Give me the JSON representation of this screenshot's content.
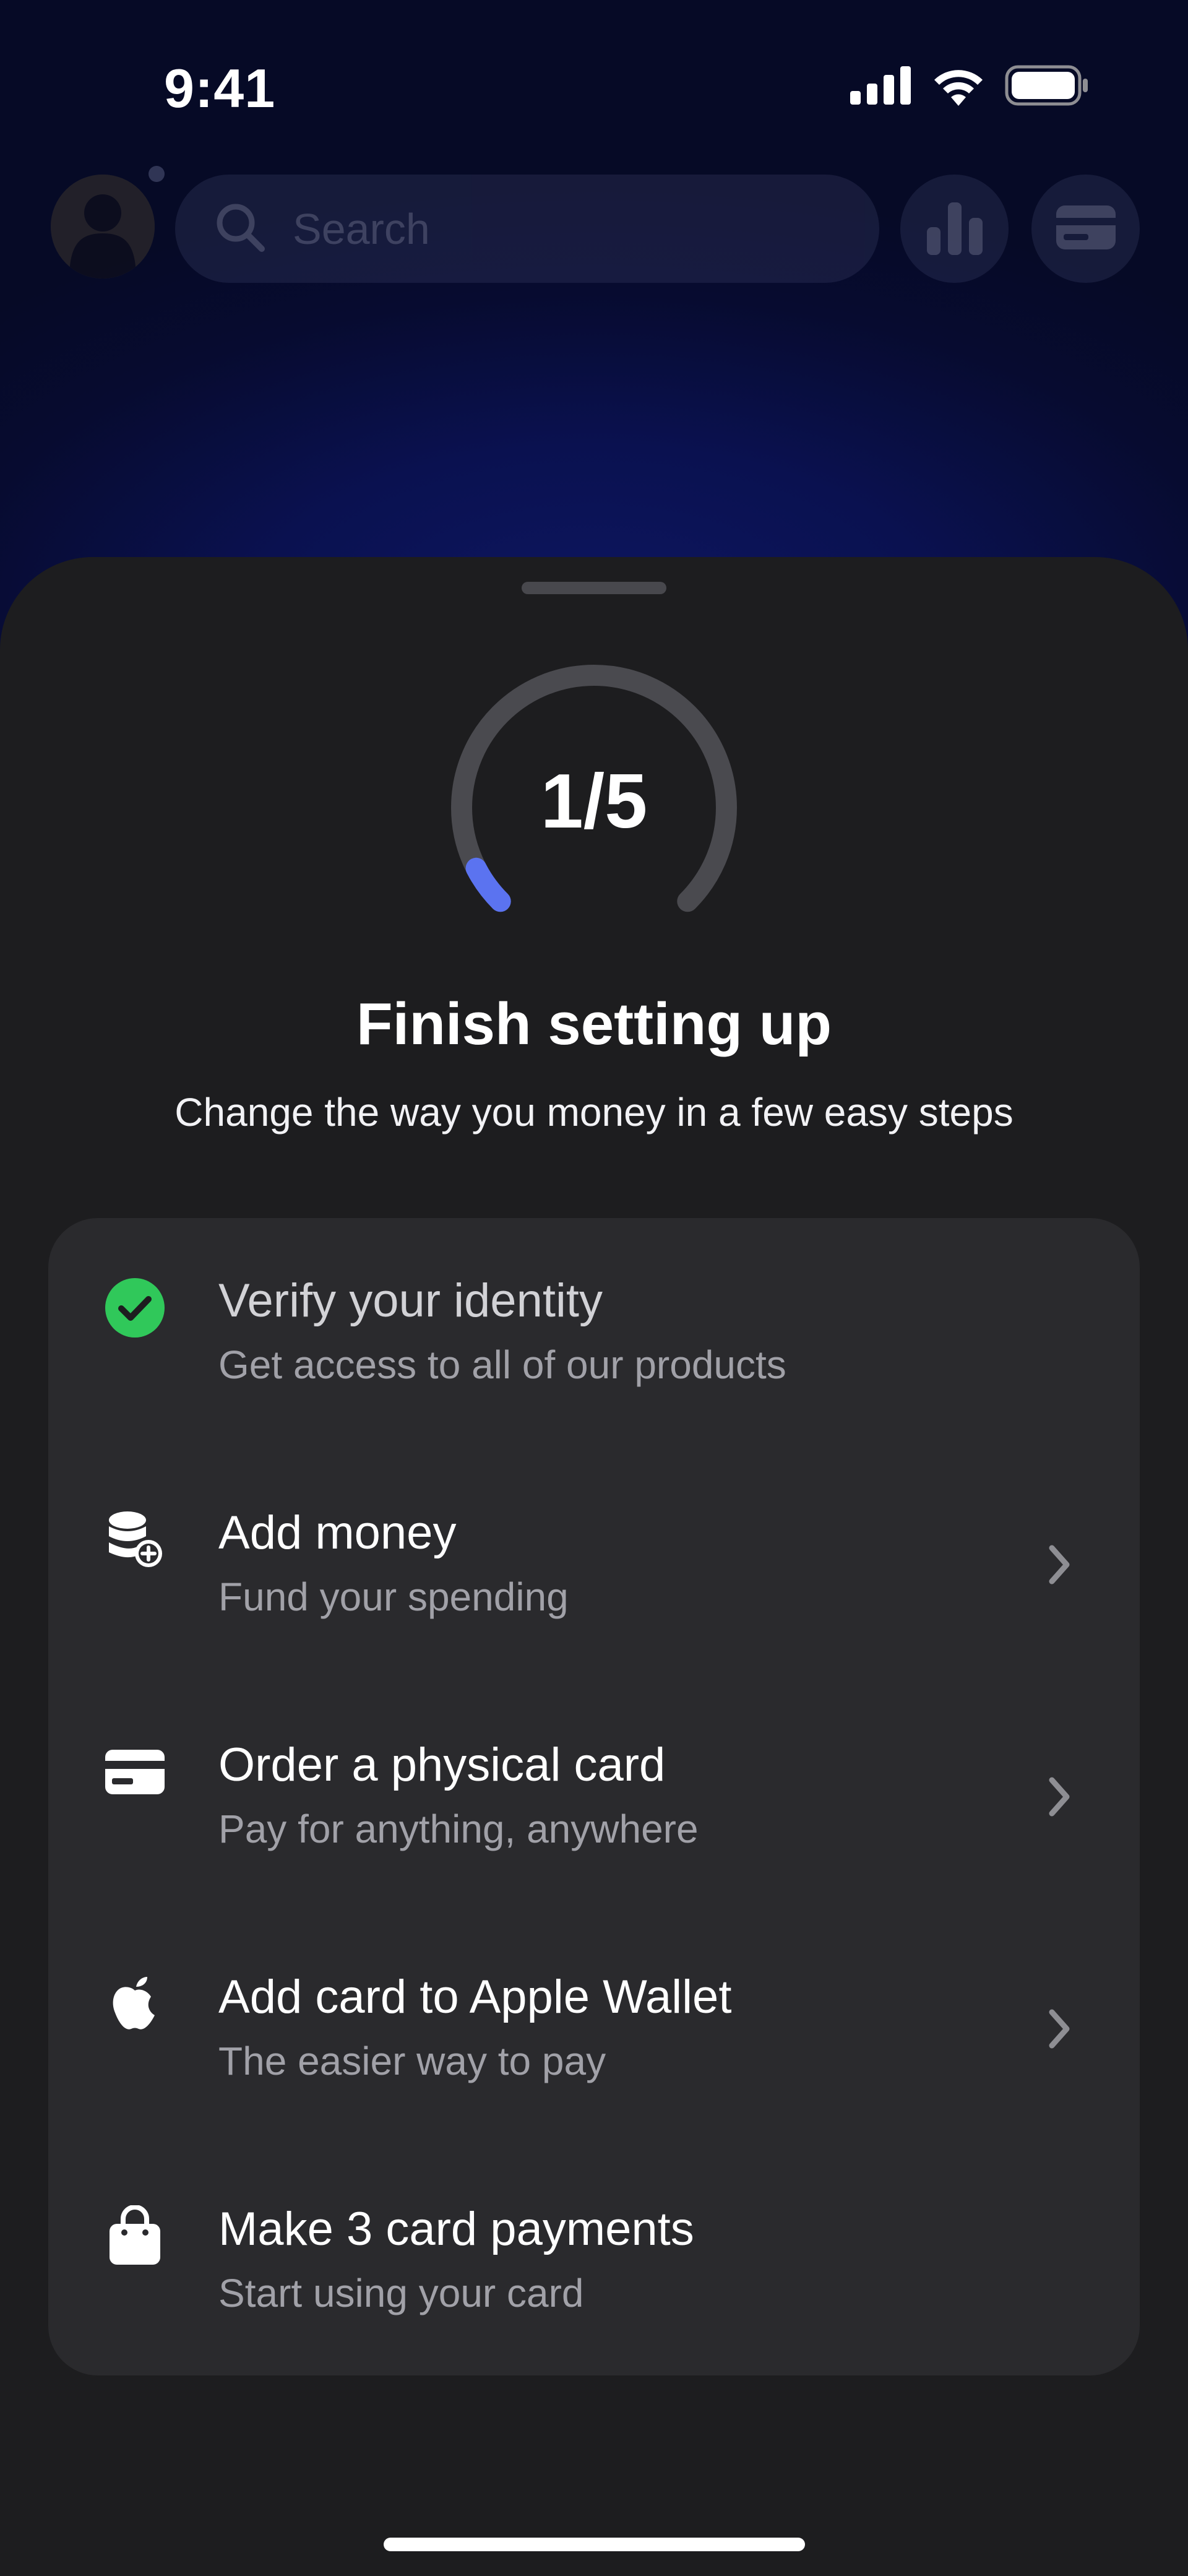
{
  "status_bar": {
    "time": "9:41",
    "icons": [
      "cellular-signal-icon",
      "wifi-icon",
      "battery-icon"
    ]
  },
  "background_app": {
    "search_placeholder": "Search",
    "buttons": [
      "analytics-icon",
      "cards-icon"
    ]
  },
  "sheet": {
    "progress": {
      "label": "1/5",
      "completed": 1,
      "total": 5
    },
    "title": "Finish setting up",
    "subtitle": "Change the way you money in a few easy steps",
    "steps": [
      {
        "title": "Verify your identity",
        "description": "Get access to all of our products",
        "icon": "checkmark-circle-icon",
        "completed": true,
        "has_chevron": false
      },
      {
        "title": "Add money",
        "description": "Fund your spending",
        "icon": "coins-add-icon",
        "completed": false,
        "has_chevron": true
      },
      {
        "title": "Order a physical card",
        "description": "Pay for anything, anywhere",
        "icon": "card-icon",
        "completed": false,
        "has_chevron": true
      },
      {
        "title": "Add card to Apple Wallet",
        "description": "The easier way to pay",
        "icon": "apple-icon",
        "completed": false,
        "has_chevron": true
      },
      {
        "title": "Make 3 card payments",
        "description": "Start using your card",
        "icon": "shopping-bag-icon",
        "completed": false,
        "has_chevron": false
      }
    ]
  },
  "colors": {
    "accent": "#5b73f0",
    "success": "#30c85a",
    "sheet_bg": "#1d1d1f",
    "card_bg": "#2a2a2d",
    "track": "#4a4a4f"
  }
}
